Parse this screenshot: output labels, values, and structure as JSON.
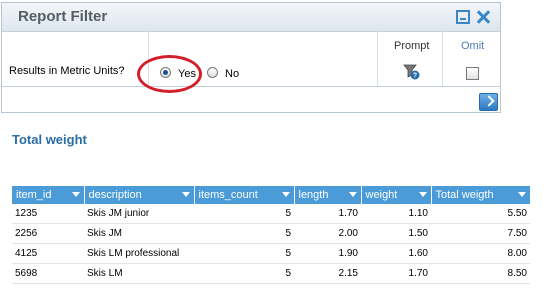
{
  "filter_panel": {
    "title": "Report Filter",
    "question": "Results in Metric Units?",
    "options": [
      {
        "label": "Yes",
        "selected": true
      },
      {
        "label": "No",
        "selected": false
      }
    ],
    "prompt_header": "Prompt",
    "omit_header": "Omit",
    "omit_checked": false,
    "icons": {
      "minimize": "minimize-icon",
      "close": "close-icon",
      "prompt": "prompt-help-icon",
      "go": "arrow-right-icon"
    },
    "highlight_color": "#d31f2a"
  },
  "report": {
    "title": "Total weight",
    "columns": [
      "item_id",
      "description",
      "items_count",
      "length",
      "weight",
      "Total weigth"
    ],
    "rows": [
      [
        "1235",
        "Skis JM junior",
        "5",
        "1.70",
        "1.10",
        "5.50"
      ],
      [
        "2256",
        "Skis JM",
        "5",
        "2.00",
        "1.50",
        "7.50"
      ],
      [
        "4125",
        "Skis LM professional",
        "5",
        "1.90",
        "1.60",
        "8.00"
      ],
      [
        "5698",
        "Skis LM",
        "5",
        "2.15",
        "1.70",
        "8.50"
      ]
    ],
    "header_color": "#4a9bd8"
  }
}
